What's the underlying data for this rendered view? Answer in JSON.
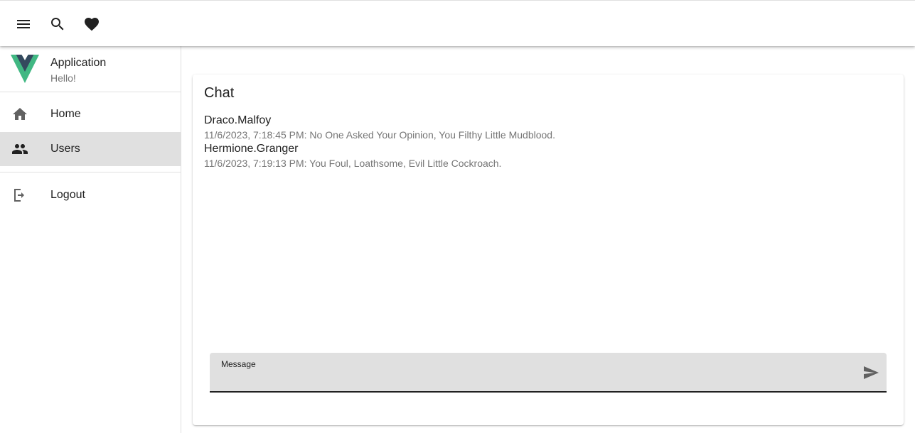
{
  "appbar": {
    "icons": [
      "menu-icon",
      "search-icon",
      "heart-icon"
    ]
  },
  "drawer": {
    "app_title": "Application",
    "app_subtitle": "Hello!",
    "items": [
      {
        "label": "Home",
        "icon": "home-icon",
        "active": false
      },
      {
        "label": "Users",
        "icon": "users-icon",
        "active": true
      },
      {
        "label": "Logout",
        "icon": "logout-icon",
        "active": false
      }
    ]
  },
  "chat": {
    "title": "Chat",
    "messages": [
      {
        "author": "Draco.Malfoy",
        "text": "11/6/2023, 7:18:45 PM: No One Asked Your Opinion, You Filthy Little Mudblood."
      },
      {
        "author": "Hermione.Granger",
        "text": "11/6/2023, 7:19:13 PM: You Foul, Loathsome, Evil Little Cockroach."
      }
    ],
    "input": {
      "label": "Message",
      "value": ""
    }
  },
  "colors": {
    "active_nav_bg": "#e0e0e0",
    "logo_green": "#41b883",
    "logo_dark": "#34495e"
  }
}
